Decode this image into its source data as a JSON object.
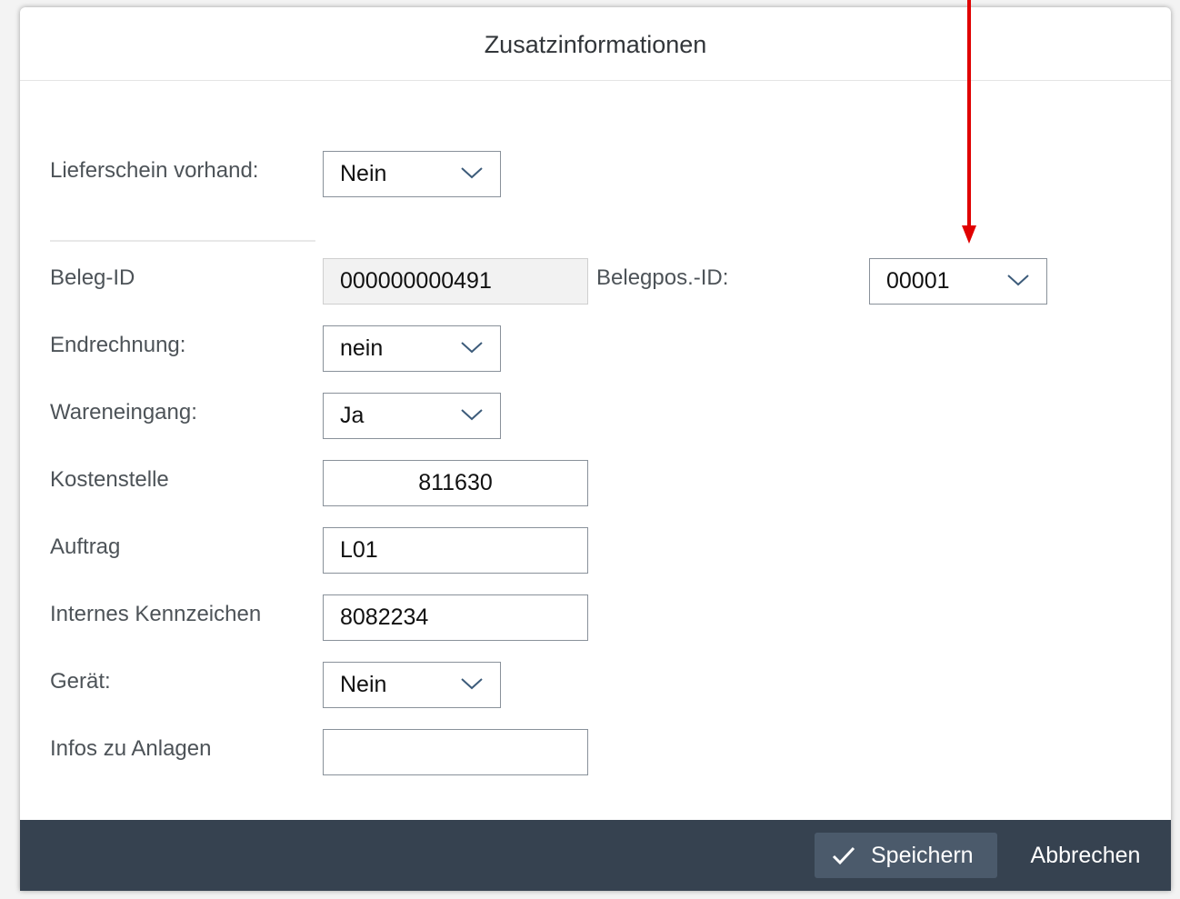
{
  "dialog": {
    "title": "Zusatzinformationen"
  },
  "form": {
    "lieferschein": {
      "label": "Lieferschein vorhand:",
      "value": "Nein"
    },
    "beleg_id": {
      "label": "Beleg-ID",
      "value": "000000000491"
    },
    "belegpos_id": {
      "label": "Belegpos.-ID:",
      "value": "00001"
    },
    "endrechnung": {
      "label": "Endrechnung:",
      "value": "nein"
    },
    "wareneingang": {
      "label": "Wareneingang:",
      "value": "Ja"
    },
    "kostenstelle": {
      "label": "Kostenstelle",
      "value": "811630"
    },
    "auftrag": {
      "label": "Auftrag",
      "value": "L01"
    },
    "internes_kennzeichen": {
      "label": "Internes Kennzeichen",
      "value": "8082234"
    },
    "geraet": {
      "label": "Gerät:",
      "value": "Nein"
    },
    "infos_anlagen": {
      "label": "Infos zu Anlagen",
      "value": ""
    }
  },
  "footer": {
    "save_label": "Speichern",
    "cancel_label": "Abbrechen"
  },
  "icons": {
    "chevron": "chevron-down-icon",
    "check": "checkmark-icon",
    "annotation": "red-arrow-annotation"
  },
  "colors": {
    "footer_bg": "#364250",
    "save_button_bg": "#4b5a6b",
    "annotation_arrow": "#e00000",
    "label_text": "#4d5358",
    "field_border": "#89919a"
  }
}
